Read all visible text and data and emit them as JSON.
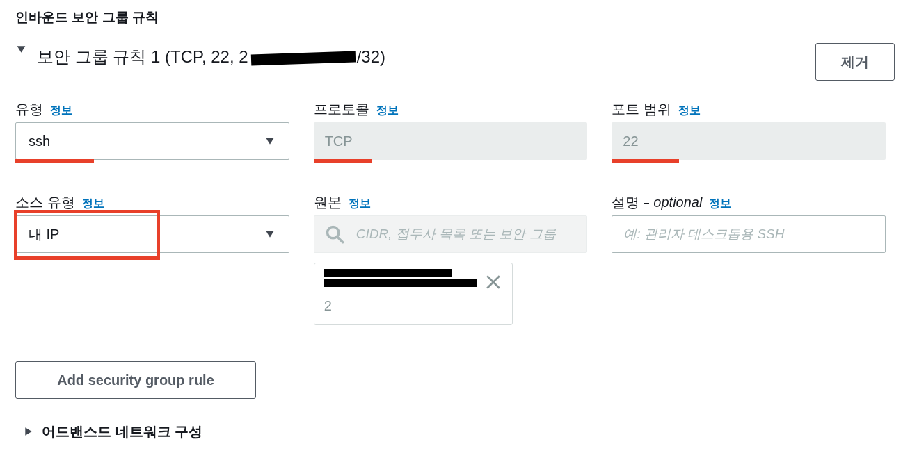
{
  "section_title": "인바운드 보안 그룹 규칙",
  "rule": {
    "expanded": true,
    "title_before": "보안 그룹 규칙 1 (TCP, 22, 2",
    "redacted": true,
    "title_after": "/32)",
    "remove_button": "제거"
  },
  "fields": [
    {
      "kind": "select",
      "label": "유형",
      "info": "정보",
      "value": "ssh",
      "underlined": true
    },
    {
      "kind": "readonly",
      "label": "프로토콜",
      "info": "정보",
      "value": "TCP",
      "underlined": true
    },
    {
      "kind": "readonly",
      "label": "포트 범위",
      "info": "정보",
      "value": "22",
      "underlined": true
    },
    {
      "kind": "select",
      "label": "소스 유형",
      "info": "정보",
      "value": "내 IP",
      "boxed": true
    },
    {
      "kind": "search",
      "label": "원본",
      "info": "정보",
      "placeholder": "CIDR, 접두사 목록 또는 보안 그룹",
      "tokens": [
        {
          "text": "2",
          "redacted": true
        }
      ]
    },
    {
      "kind": "text",
      "label": "설명",
      "label_suffix": "optional",
      "info": "정보",
      "placeholder": "예: 관리자 데스크톱용 SSH"
    }
  ],
  "add_button": "Add security group rule",
  "advanced": {
    "label": "어드밴스드 네트워크 구성",
    "expanded": false
  }
}
